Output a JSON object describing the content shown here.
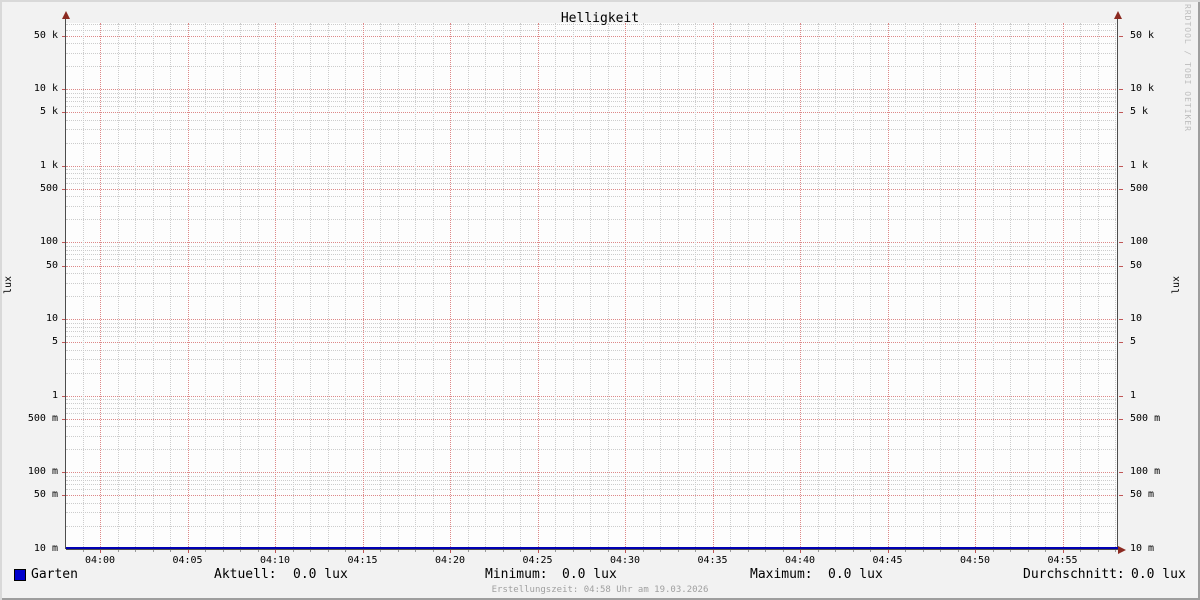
{
  "title": "Helligkeit",
  "watermark": "RRDTOOL / TOBI OETIKER",
  "axes": {
    "y_unit_left": "lux",
    "y_unit_right": "lux",
    "y_ticks": [
      {
        "label": "50 k",
        "value": 50000
      },
      {
        "label": "10 k",
        "value": 10000
      },
      {
        "label": "5 k",
        "value": 5000
      },
      {
        "label": "1 k",
        "value": 1000
      },
      {
        "label": "500",
        "value": 500
      },
      {
        "label": "100",
        "value": 100
      },
      {
        "label": "50",
        "value": 50
      },
      {
        "label": "10",
        "value": 10
      },
      {
        "label": "5",
        "value": 5
      },
      {
        "label": "1",
        "value": 1
      },
      {
        "label": "500 m",
        "value": 0.5
      },
      {
        "label": "100 m",
        "value": 0.1
      },
      {
        "label": "50 m",
        "value": 0.05
      },
      {
        "label": "10 m",
        "value": 0.01
      }
    ],
    "x_ticks": [
      {
        "label": "04:00",
        "minute": 0
      },
      {
        "label": "04:05",
        "minute": 5
      },
      {
        "label": "04:10",
        "minute": 10
      },
      {
        "label": "04:15",
        "minute": 15
      },
      {
        "label": "04:20",
        "minute": 20
      },
      {
        "label": "04:25",
        "minute": 25
      },
      {
        "label": "04:30",
        "minute": 30
      },
      {
        "label": "04:35",
        "minute": 35
      },
      {
        "label": "04:40",
        "minute": 40
      },
      {
        "label": "04:45",
        "minute": 45
      },
      {
        "label": "04:50",
        "minute": 50
      },
      {
        "label": "04:55",
        "minute": 55
      }
    ]
  },
  "legend": {
    "series": {
      "label": "Garten",
      "color": "#0000cc"
    },
    "stats": [
      {
        "label": "Aktuell:",
        "value": "0.0 lux"
      },
      {
        "label": "Minimum:",
        "value": "0.0 lux"
      },
      {
        "label": "Maximum:",
        "value": "0.0 lux"
      },
      {
        "label": "Durchschnitt:",
        "value": "0.0 lux"
      }
    ]
  },
  "footer": "Erstellungszeit: 04:58 Uhr am 19.03.2026",
  "colors": {
    "major_grid": "#dd8888",
    "minor_grid": "#cccccc",
    "axis": "#4d4d4d",
    "arrow": "#8b2a21",
    "series_line": "#0000b3",
    "series_swatch": "#0000cc",
    "canvas": "#fdfdfd",
    "background": "#f2f2f2"
  },
  "chart_data": {
    "type": "line",
    "title": "Helligkeit",
    "xlabel": "",
    "ylabel": "lux",
    "y_scale": "log",
    "ylim": [
      0.01,
      70000
    ],
    "x_range": [
      "03:58",
      "04:58"
    ],
    "x_tick_labels": [
      "04:00",
      "04:05",
      "04:10",
      "04:15",
      "04:20",
      "04:25",
      "04:30",
      "04:35",
      "04:40",
      "04:45",
      "04:50",
      "04:55"
    ],
    "y_tick_labels": [
      "50 k",
      "10 k",
      "5 k",
      "1 k",
      "500",
      "100",
      "50",
      "10",
      "5",
      "1",
      "500 m",
      "100 m",
      "50 m",
      "10 m"
    ],
    "grid": true,
    "legend_position": "bottom",
    "series": [
      {
        "name": "Garten",
        "color": "#0000cc",
        "unit": "lux",
        "constant_value": 0.0
      }
    ],
    "stats": {
      "aktuell": "0.0 lux",
      "minimum": "0.0 lux",
      "maximum": "0.0 lux",
      "durchschnitt": "0.0 lux"
    }
  }
}
